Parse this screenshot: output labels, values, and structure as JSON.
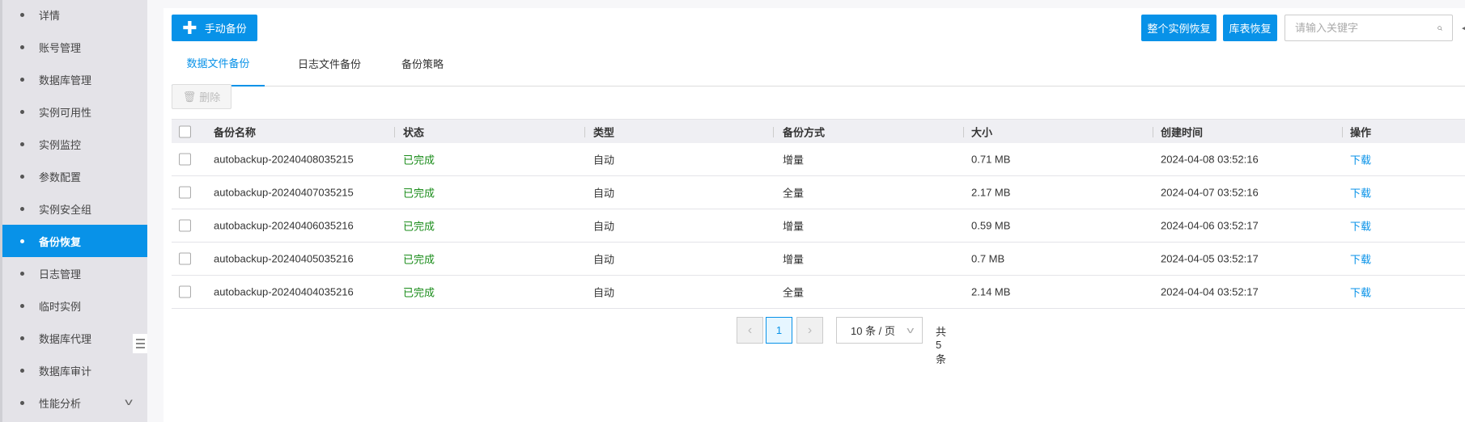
{
  "sidebar": {
    "items": [
      {
        "label": "详情"
      },
      {
        "label": "账号管理"
      },
      {
        "label": "数据库管理"
      },
      {
        "label": "实例可用性"
      },
      {
        "label": "实例监控"
      },
      {
        "label": "参数配置"
      },
      {
        "label": "实例安全组"
      },
      {
        "label": "备份恢复",
        "active": true
      },
      {
        "label": "日志管理"
      },
      {
        "label": "临时实例"
      },
      {
        "label": "数据库代理"
      },
      {
        "label": "数据库审计"
      },
      {
        "label": "性能分析",
        "expandable": true
      }
    ]
  },
  "toolbar": {
    "manual_backup": "手动备份",
    "full_restore": "整个实例恢复",
    "table_restore": "库表恢复",
    "search_placeholder": "请输入关键字",
    "search_value": ""
  },
  "tabs": [
    {
      "label": "数据文件备份",
      "active": true
    },
    {
      "label": "日志文件备份"
    },
    {
      "label": "备份策略"
    }
  ],
  "actions": {
    "delete": "删除"
  },
  "table": {
    "headers": [
      "备份名称",
      "状态",
      "类型",
      "备份方式",
      "大小",
      "创建时间",
      "操作"
    ],
    "rows": [
      {
        "name": "autobackup-20240408035215",
        "status": "已完成",
        "type": "自动",
        "mode": "增量",
        "size": "0.71 MB",
        "created": "2024-04-08 03:52:16",
        "action": "下载"
      },
      {
        "name": "autobackup-20240407035215",
        "status": "已完成",
        "type": "自动",
        "mode": "全量",
        "size": "2.17 MB",
        "created": "2024-04-07 03:52:16",
        "action": "下载"
      },
      {
        "name": "autobackup-20240406035216",
        "status": "已完成",
        "type": "自动",
        "mode": "增量",
        "size": "0.59 MB",
        "created": "2024-04-06 03:52:17",
        "action": "下载"
      },
      {
        "name": "autobackup-20240405035216",
        "status": "已完成",
        "type": "自动",
        "mode": "增量",
        "size": "0.7 MB",
        "created": "2024-04-05 03:52:17",
        "action": "下载"
      },
      {
        "name": "autobackup-20240404035216",
        "status": "已完成",
        "type": "自动",
        "mode": "全量",
        "size": "2.14 MB",
        "created": "2024-04-04 03:52:17",
        "action": "下载"
      }
    ]
  },
  "pagination": {
    "current_page": "1",
    "page_size": "10 条 / 页",
    "total": "共 5 条"
  },
  "colors": {
    "primary": "#0892e8",
    "success": "#1a8c1a",
    "sidebar_bg": "#e4e3e8"
  }
}
